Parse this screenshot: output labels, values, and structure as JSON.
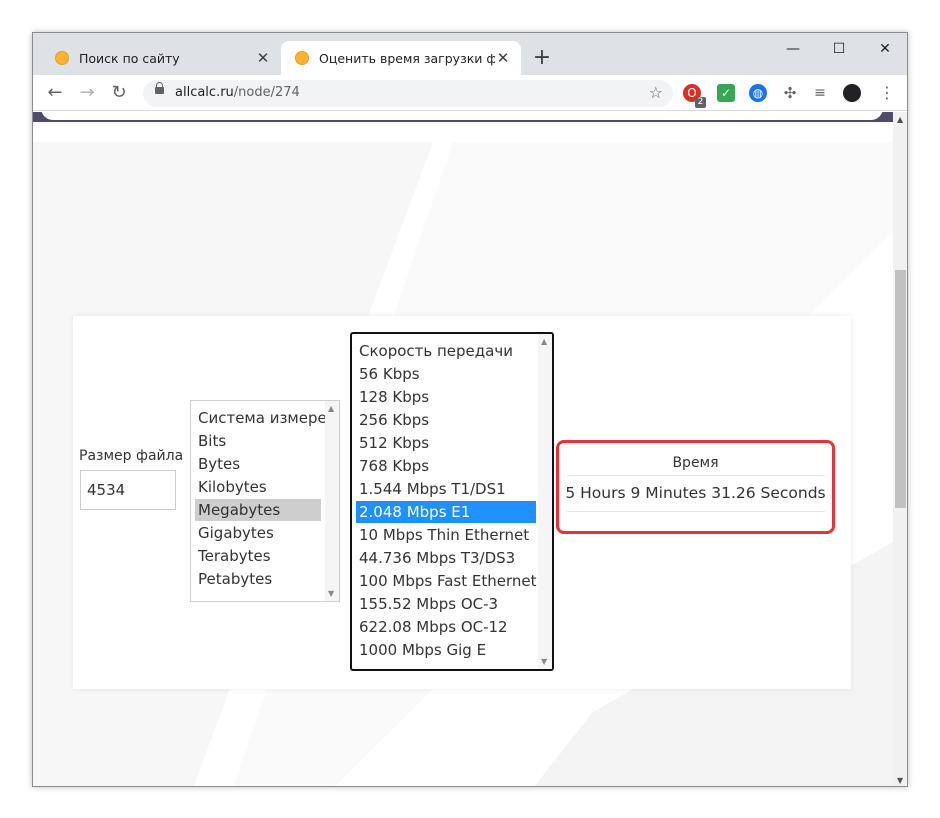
{
  "browser": {
    "tabs": [
      {
        "title": "Поиск по сайту",
        "active": false
      },
      {
        "title": "Оценить время загрузки файла",
        "active": true
      }
    ],
    "new_tab_glyph": "+",
    "window_controls": {
      "minimize": "—",
      "maximize": "☐",
      "close": "✕"
    },
    "url_host": "allcalc.ru",
    "url_path": "/node/274",
    "extension_badge": "2"
  },
  "form": {
    "file_size_label": "Размер файла",
    "file_size_value": "4534",
    "units": {
      "options": [
        "Система измере",
        "Bits",
        "Bytes",
        "Kilobytes",
        "Megabytes",
        "Gigabytes",
        "Terabytes",
        "Petabytes"
      ],
      "selected": "Megabytes"
    },
    "speed": {
      "options": [
        "Скорость передачи",
        "56 Kbps",
        "128 Kbps",
        "256 Kbps",
        "512 Kbps",
        "768 Kbps",
        "1.544 Mbps T1/DS1",
        "2.048 Mbps E1",
        "10 Mbps Thin Ethernet",
        "44.736 Mbps T3/DS3",
        "100 Mbps Fast Ethernet",
        "155.52 Mbps OC-3",
        "622.08 Mbps OC-12",
        "1000 Mbps Gig E"
      ],
      "selected": "2.048 Mbps E1"
    },
    "result_label": "Время",
    "result_value": "5 Hours 9 Minutes 31.26 Seconds"
  },
  "colors": {
    "highlight_border": "#e4343b",
    "selected_blue": "#1e90ff",
    "header_strip": "#4d4b6b"
  },
  "icons": [
    "back-icon",
    "forward-icon",
    "reload-icon",
    "lock-icon",
    "star-icon",
    "puzzle-icon",
    "menu-icon"
  ]
}
